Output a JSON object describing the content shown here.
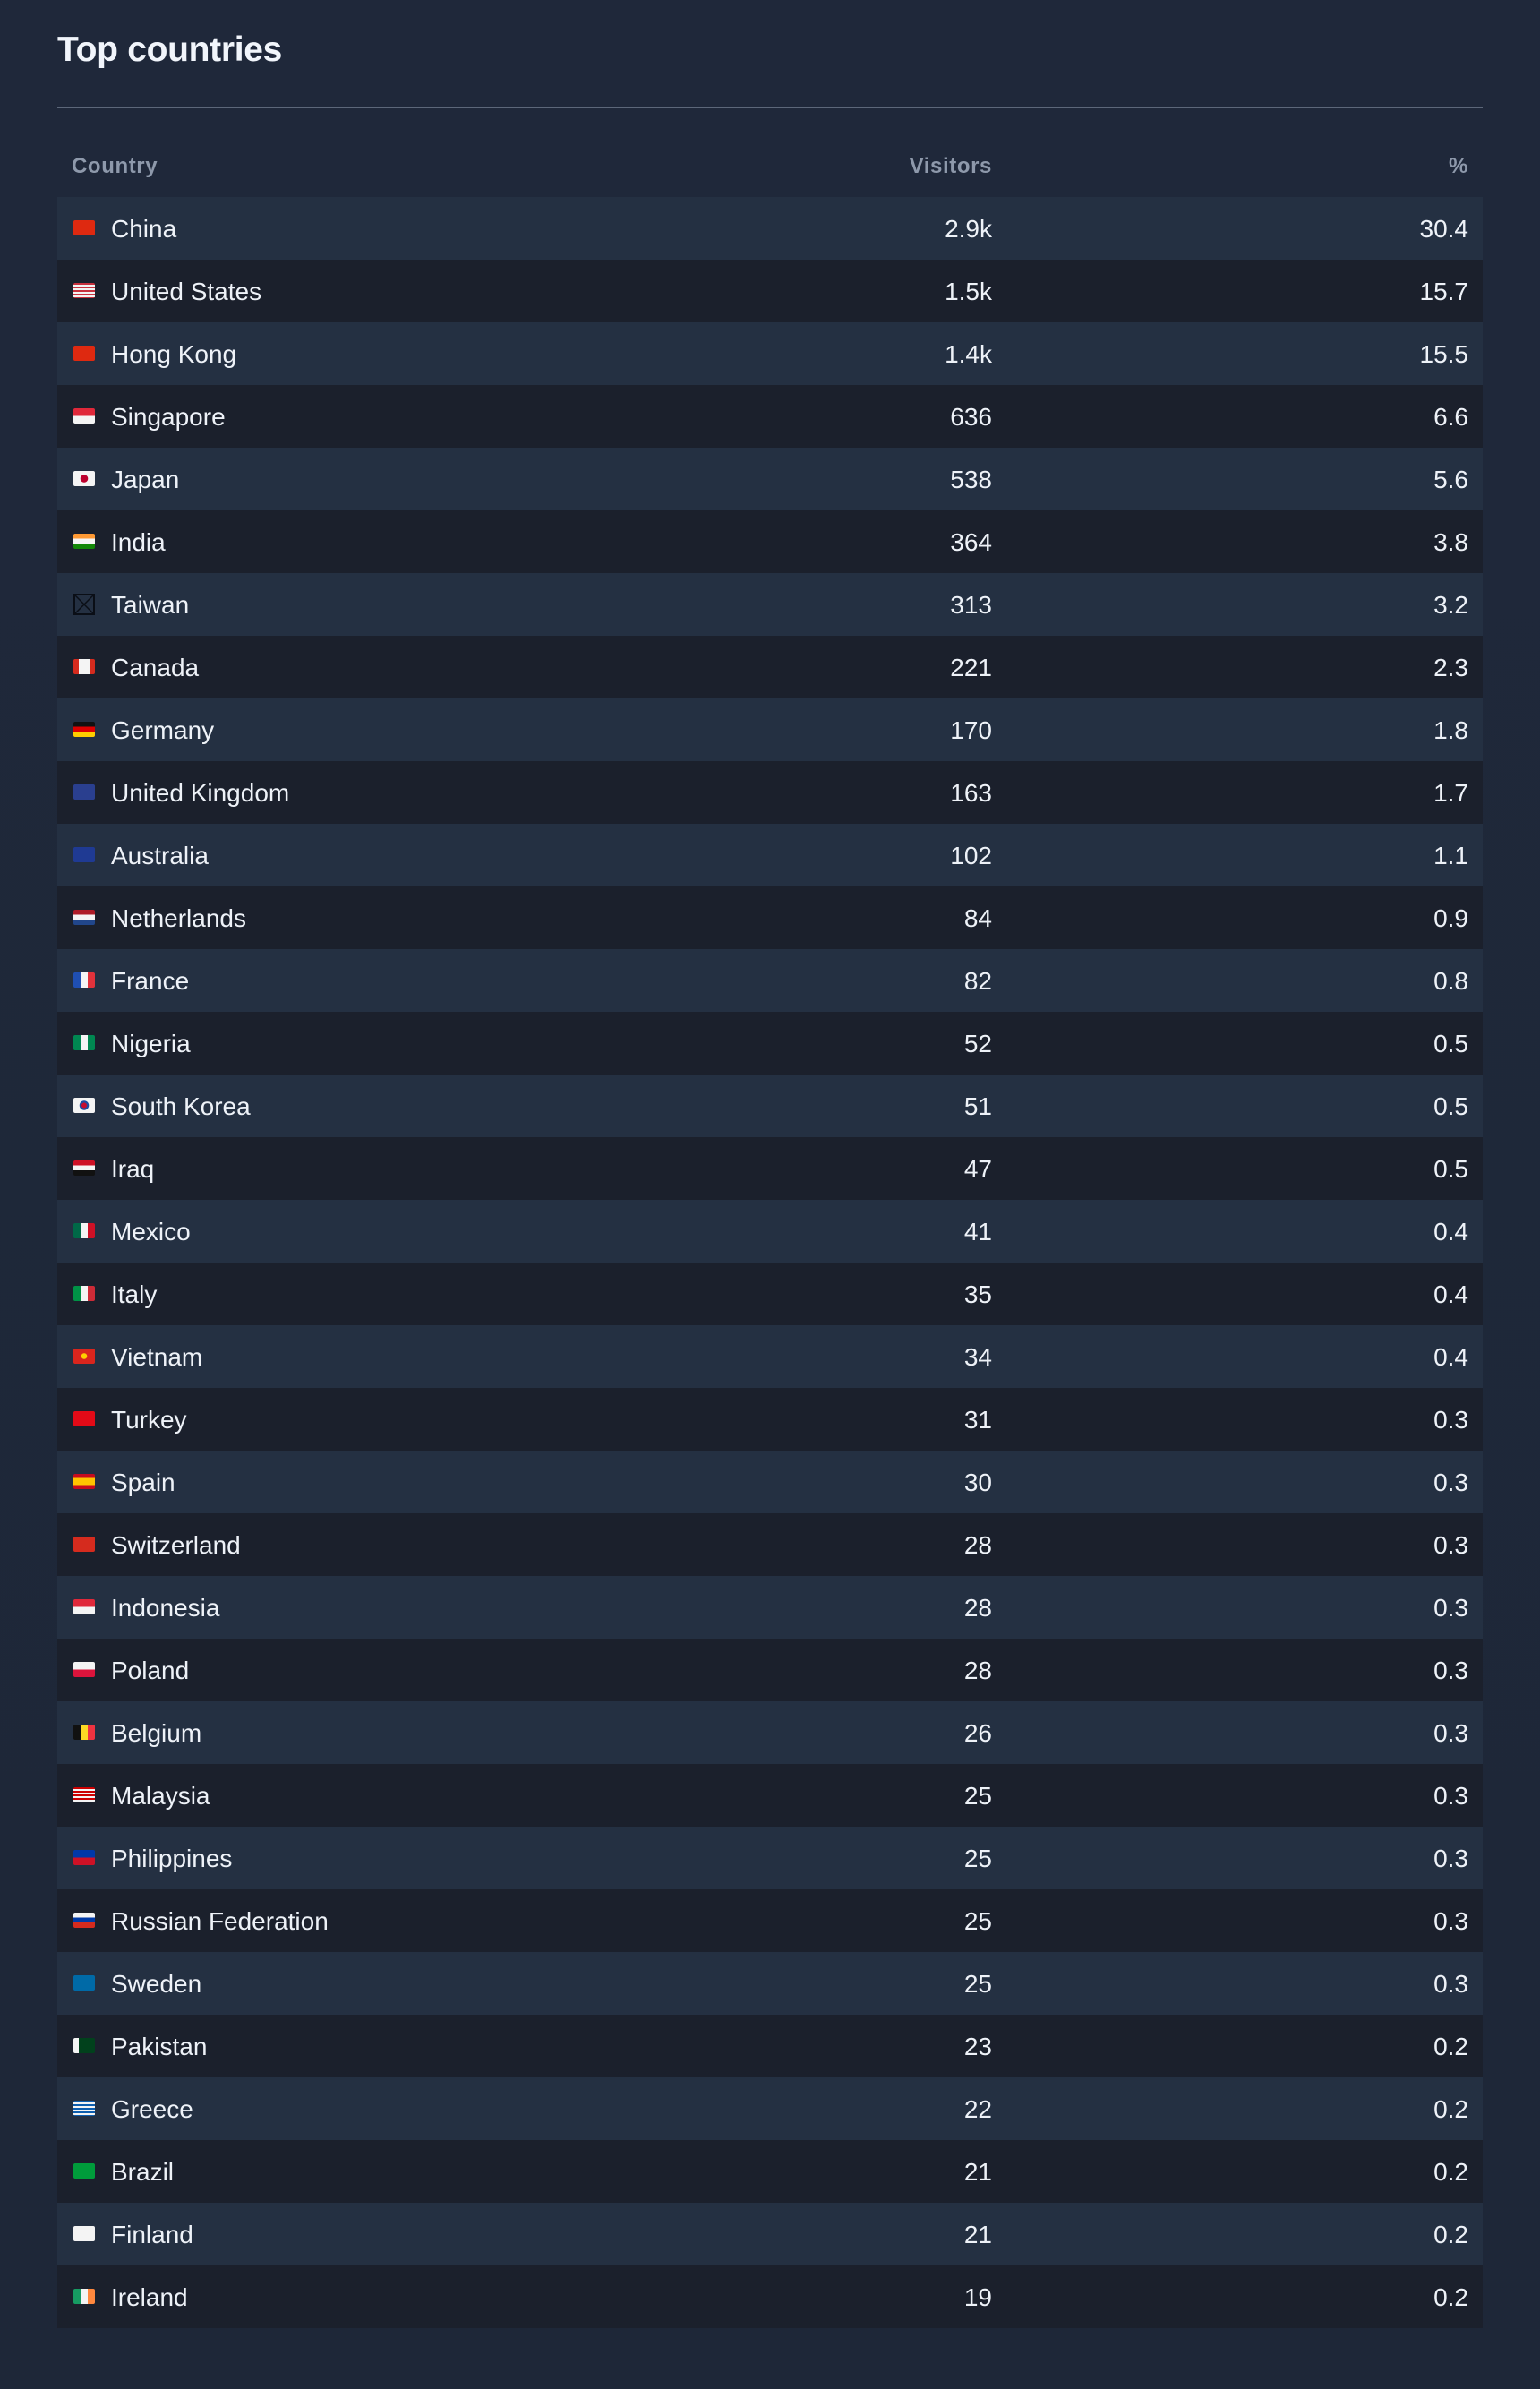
{
  "panel": {
    "title": "Top countries",
    "columns": {
      "country": "Country",
      "visitors": "Visitors",
      "percent": "%"
    }
  },
  "rows": [
    {
      "country": "China",
      "flag": "cn-flag-icon",
      "visitors": "2.9k",
      "percent": "30.4"
    },
    {
      "country": "United States",
      "flag": "us-flag-icon",
      "visitors": "1.5k",
      "percent": "15.7"
    },
    {
      "country": "Hong Kong",
      "flag": "hk-flag-icon",
      "visitors": "1.4k",
      "percent": "15.5"
    },
    {
      "country": "Singapore",
      "flag": "sg-flag-icon",
      "visitors": "636",
      "percent": "6.6"
    },
    {
      "country": "Japan",
      "flag": "jp-flag-icon",
      "visitors": "538",
      "percent": "5.6"
    },
    {
      "country": "India",
      "flag": "in-flag-icon",
      "visitors": "364",
      "percent": "3.8"
    },
    {
      "country": "Taiwan",
      "flag": "missing-glyph-icon",
      "visitors": "313",
      "percent": "3.2"
    },
    {
      "country": "Canada",
      "flag": "ca-flag-icon",
      "visitors": "221",
      "percent": "2.3"
    },
    {
      "country": "Germany",
      "flag": "de-flag-icon",
      "visitors": "170",
      "percent": "1.8"
    },
    {
      "country": "United Kingdom",
      "flag": "gb-flag-icon",
      "visitors": "163",
      "percent": "1.7"
    },
    {
      "country": "Australia",
      "flag": "au-flag-icon",
      "visitors": "102",
      "percent": "1.1"
    },
    {
      "country": "Netherlands",
      "flag": "nl-flag-icon",
      "visitors": "84",
      "percent": "0.9"
    },
    {
      "country": "France",
      "flag": "fr-flag-icon",
      "visitors": "82",
      "percent": "0.8"
    },
    {
      "country": "Nigeria",
      "flag": "ng-flag-icon",
      "visitors": "52",
      "percent": "0.5"
    },
    {
      "country": "South Korea",
      "flag": "kr-flag-icon",
      "visitors": "51",
      "percent": "0.5"
    },
    {
      "country": "Iraq",
      "flag": "iq-flag-icon",
      "visitors": "47",
      "percent": "0.5"
    },
    {
      "country": "Mexico",
      "flag": "mx-flag-icon",
      "visitors": "41",
      "percent": "0.4"
    },
    {
      "country": "Italy",
      "flag": "it-flag-icon",
      "visitors": "35",
      "percent": "0.4"
    },
    {
      "country": "Vietnam",
      "flag": "vn-flag-icon",
      "visitors": "34",
      "percent": "0.4"
    },
    {
      "country": "Turkey",
      "flag": "tr-flag-icon",
      "visitors": "31",
      "percent": "0.3"
    },
    {
      "country": "Spain",
      "flag": "es-flag-icon",
      "visitors": "30",
      "percent": "0.3"
    },
    {
      "country": "Switzerland",
      "flag": "ch-flag-icon",
      "visitors": "28",
      "percent": "0.3"
    },
    {
      "country": "Indonesia",
      "flag": "id-flag-icon",
      "visitors": "28",
      "percent": "0.3"
    },
    {
      "country": "Poland",
      "flag": "pl-flag-icon",
      "visitors": "28",
      "percent": "0.3"
    },
    {
      "country": "Belgium",
      "flag": "be-flag-icon",
      "visitors": "26",
      "percent": "0.3"
    },
    {
      "country": "Malaysia",
      "flag": "my-flag-icon",
      "visitors": "25",
      "percent": "0.3"
    },
    {
      "country": "Philippines",
      "flag": "ph-flag-icon",
      "visitors": "25",
      "percent": "0.3"
    },
    {
      "country": "Russian Federation",
      "flag": "ru-flag-icon",
      "visitors": "25",
      "percent": "0.3"
    },
    {
      "country": "Sweden",
      "flag": "se-flag-icon",
      "visitors": "25",
      "percent": "0.3"
    },
    {
      "country": "Pakistan",
      "flag": "pk-flag-icon",
      "visitors": "23",
      "percent": "0.2"
    },
    {
      "country": "Greece",
      "flag": "gr-flag-icon",
      "visitors": "22",
      "percent": "0.2"
    },
    {
      "country": "Brazil",
      "flag": "br-flag-icon",
      "visitors": "21",
      "percent": "0.2"
    },
    {
      "country": "Finland",
      "flag": "fi-flag-icon",
      "visitors": "21",
      "percent": "0.2"
    },
    {
      "country": "Ireland",
      "flag": "ie-flag-icon",
      "visitors": "19",
      "percent": "0.2"
    }
  ],
  "flag_styles": {
    "cn-flag-icon": "linear-gradient(#de2910,#de2910)",
    "us-flag-icon": "repeating-linear-gradient(180deg,#c8313e 0 2px,#f3f3f3 2px 4px)",
    "hk-flag-icon": "linear-gradient(#de2910,#de2910)",
    "sg-flag-icon": "linear-gradient(180deg,#e0283a 0 50%,#f4f4f4 50% 100%)",
    "jp-flag-icon": "radial-gradient(circle at 50% 50%,#bc002d 0 4px,#f4f4f4 4.5px)",
    "in-flag-icon": "linear-gradient(180deg,#ff9933 0 33%,#f5f5f5 33% 66%,#138808 66% 100%)",
    "missing-glyph-icon": "transparent",
    "ca-flag-icon": "linear-gradient(90deg,#d52b1e 0 25%,#f4f4f4 25% 75%,#d52b1e 75% 100%)",
    "de-flag-icon": "linear-gradient(180deg,#111 0 33%,#dd0000 33% 66%,#ffce00 66% 100%)",
    "gb-flag-icon": "linear-gradient(#2a3f8f,#2a3f8f)",
    "au-flag-icon": "linear-gradient(#1f3a93,#1f3a93)",
    "nl-flag-icon": "linear-gradient(180deg,#ae1c28 0 33%,#f4f4f4 33% 66%,#21468b 66% 100%)",
    "fr-flag-icon": "linear-gradient(90deg,#1f4fb3 0 33%,#f4f4f4 33% 66%,#e1323b 66% 100%)",
    "ng-flag-icon": "linear-gradient(90deg,#008751 0 33%,#f4f4f4 33% 66%,#008751 66% 100%)",
    "kr-flag-icon": "radial-gradient(circle at 50% 50%,#c60c30 0 3px,#1e4ca1 3px 5px,#f4f4f4 5.5px)",
    "iq-flag-icon": "linear-gradient(180deg,#ce1126 0 33%,#f4f4f4 33% 66%,#111 66% 100%)",
    "mx-flag-icon": "linear-gradient(90deg,#006847 0 33%,#f4f4f4 33% 66%,#ce1126 66% 100%)",
    "it-flag-icon": "linear-gradient(90deg,#009246 0 33%,#f4f4f4 33% 66%,#ce2b37 66% 100%)",
    "vn-flag-icon": "radial-gradient(circle at 50% 50%,#ffcd00 0 3px,#da251d 3.5px)",
    "tr-flag-icon": "linear-gradient(#e30a17,#e30a17)",
    "es-flag-icon": "linear-gradient(180deg,#c60b1e 0 25%,#ffc400 25% 75%,#c60b1e 75% 100%)",
    "ch-flag-icon": "linear-gradient(#d52b1e,#d52b1e)",
    "id-flag-icon": "linear-gradient(180deg,#e0283a 0 50%,#f4f4f4 50% 100%)",
    "pl-flag-icon": "linear-gradient(180deg,#f4f4f4 0 50%,#dc143c 50% 100%)",
    "be-flag-icon": "linear-gradient(90deg,#111 0 33%,#fdda24 33% 66%,#ef3340 66% 100%)",
    "my-flag-icon": "repeating-linear-gradient(180deg,#cc0001 0 2px,#f4f4f4 2px 4px)",
    "ph-flag-icon": "linear-gradient(180deg,#0038a8 0 50%,#ce1126 50% 100%)",
    "ru-flag-icon": "linear-gradient(180deg,#f4f4f4 0 33%,#0039a6 33% 66%,#d52b1e 66% 100%)",
    "se-flag-icon": "linear-gradient(#006aa7,#006aa7)",
    "pk-flag-icon": "linear-gradient(90deg,#f4f4f4 0 25%,#01411c 25% 100%)",
    "gr-flag-icon": "repeating-linear-gradient(180deg,#0d5eaf 0 2px,#f4f4f4 2px 4px)",
    "br-flag-icon": "linear-gradient(#009c3b,#009c3b)",
    "fi-flag-icon": "linear-gradient(#f4f4f4,#f4f4f4)",
    "ie-flag-icon": "linear-gradient(90deg,#169b62 0 33%,#f4f4f4 33% 66%,#ff883e 66% 100%)"
  }
}
